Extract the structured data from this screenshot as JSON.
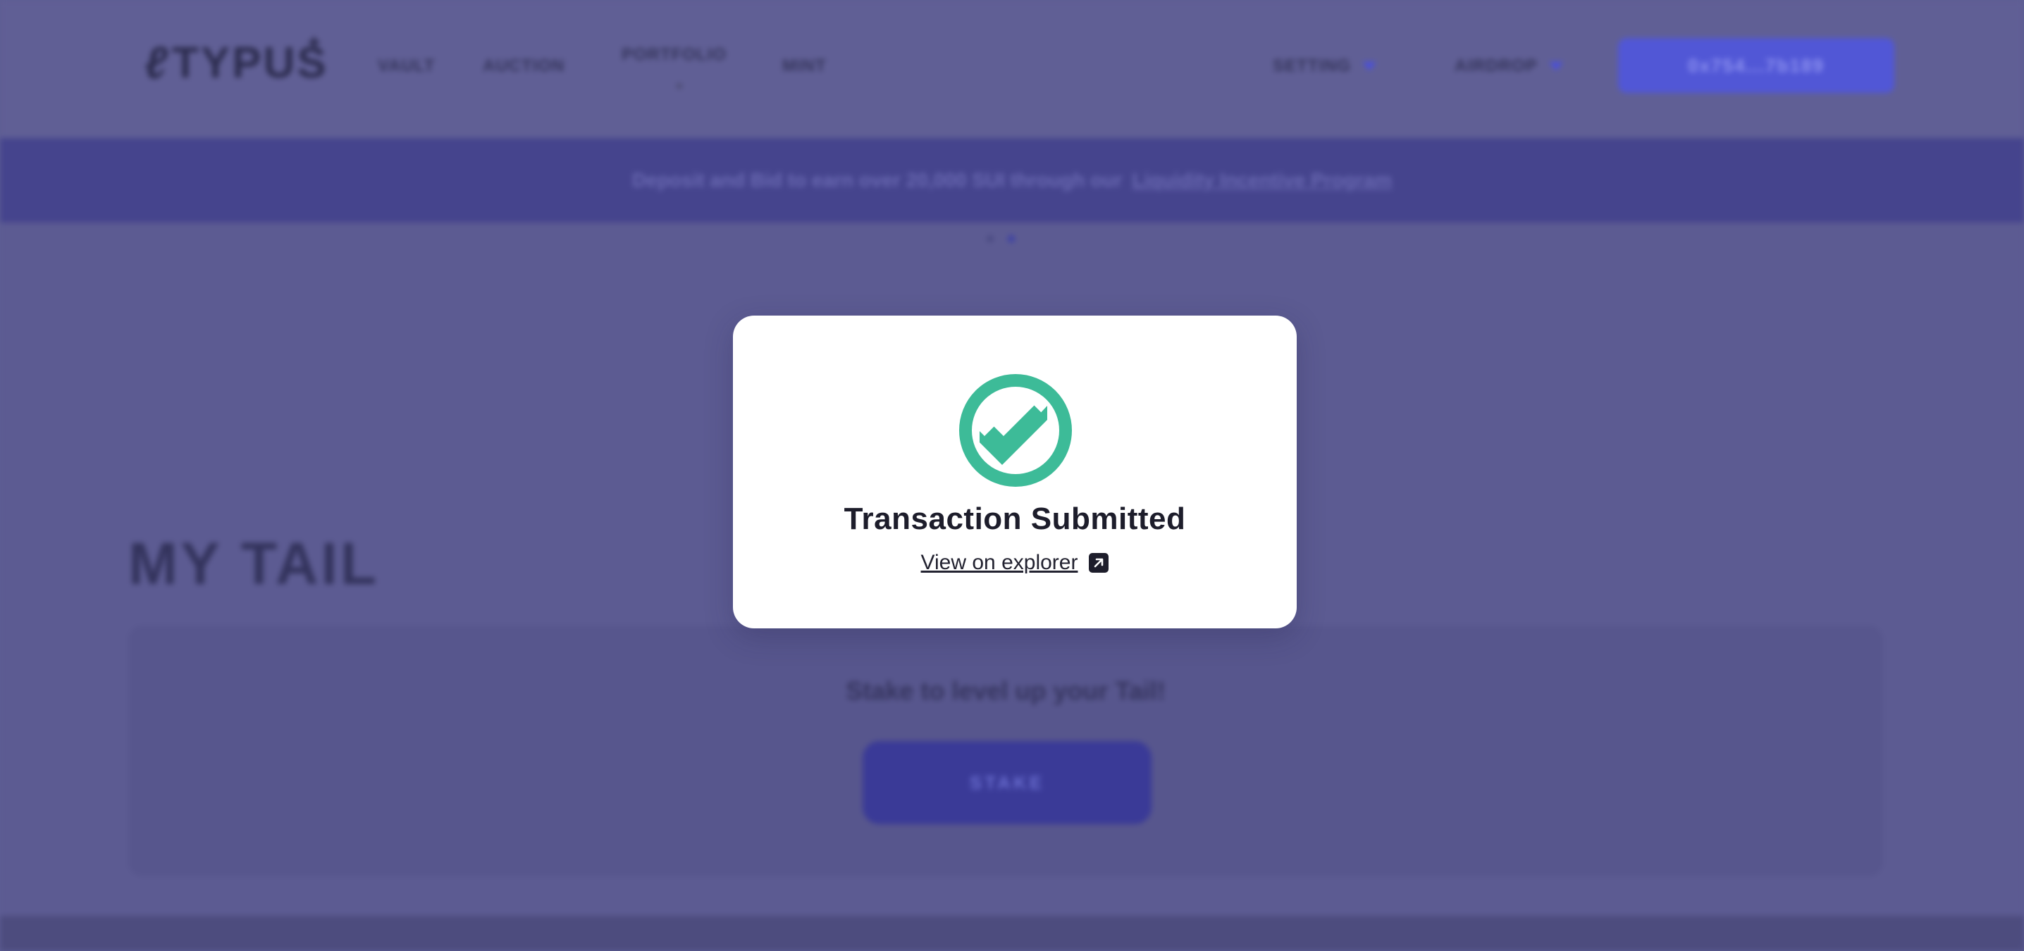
{
  "header": {
    "logo_text": "TYPUS",
    "nav": {
      "vault": "VAULT",
      "auction": "AUCTION",
      "portfolio": "PORTFOLIO",
      "mint": "MINT"
    },
    "setting_label": "SETTING",
    "airdrop_label": "AIRDROP",
    "wallet_address": "0x754...7b189"
  },
  "banner": {
    "text": "Deposit and Bid to earn over 20,000 SUI through our",
    "link_text": "Liquidity Incentive Program"
  },
  "main": {
    "section_title": "MY TAIL",
    "tail_card_text": "Stake to level up your Tail!",
    "stake_button_label": "STAKE"
  },
  "modal": {
    "title": "Transaction Submitted",
    "explorer_link": "View on explorer",
    "icon": "check-circle-icon",
    "icon_color": "#3dbb98"
  },
  "colors": {
    "accent": "#4a4fdc",
    "overlay": "#5c5b92",
    "success": "#3dbb98"
  }
}
